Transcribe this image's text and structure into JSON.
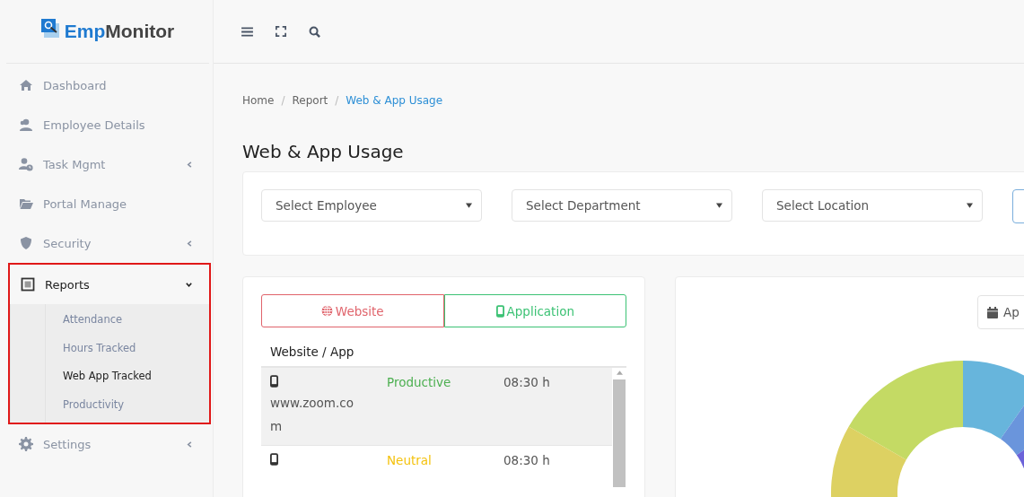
{
  "logo": {
    "part_1": "Emp",
    "part_2": "Monitor"
  },
  "sidebar": {
    "items": [
      {
        "label": "Dashboard",
        "has_arrow": false,
        "expanded": false,
        "highlighted": false
      },
      {
        "label": "Employee Details",
        "has_arrow": false,
        "expanded": false,
        "highlighted": false
      },
      {
        "label": "Task Mgmt",
        "has_arrow": true,
        "expanded": false,
        "highlighted": false
      },
      {
        "label": "Portal Manage",
        "has_arrow": false,
        "expanded": false,
        "highlighted": false
      },
      {
        "label": "Security",
        "has_arrow": true,
        "expanded": false,
        "highlighted": false
      },
      {
        "label": "Reports",
        "has_arrow": true,
        "expanded": true,
        "highlighted": true,
        "children": [
          {
            "label": "Attendance",
            "selected": false
          },
          {
            "label": "Hours Tracked",
            "selected": false
          },
          {
            "label": "Web App Tracked",
            "selected": true
          },
          {
            "label": "Productivity",
            "selected": false
          }
        ]
      },
      {
        "label": "Settings",
        "has_arrow": true,
        "expanded": false,
        "highlighted": false
      }
    ]
  },
  "breadcrumb": [
    {
      "label": "Home",
      "current": false
    },
    {
      "label": "Report",
      "current": false
    },
    {
      "label": "Web & App Usage",
      "current": true
    }
  ],
  "breadcrumb_separators": [
    "/",
    "/"
  ],
  "page_title": "Web & App Usage",
  "filters": [
    {
      "placeholder": "Select Employee"
    },
    {
      "placeholder": "Select Department"
    },
    {
      "placeholder": "Select Location"
    }
  ],
  "usage_tabs": [
    {
      "label": "Website",
      "kind": "website"
    },
    {
      "label": "Application",
      "kind": "application"
    }
  ],
  "table": {
    "header": "Website / App",
    "rows": [
      {
        "site": "www.zoom.com",
        "status": "Productive",
        "color": "#4caf50",
        "time": "08:30 h",
        "selected": true
      },
      {
        "status": "Neutral",
        "color": "#f4c20d",
        "time": "08:30 h",
        "selected": false
      }
    ]
  },
  "date_button": {
    "label": "Ap"
  }
}
